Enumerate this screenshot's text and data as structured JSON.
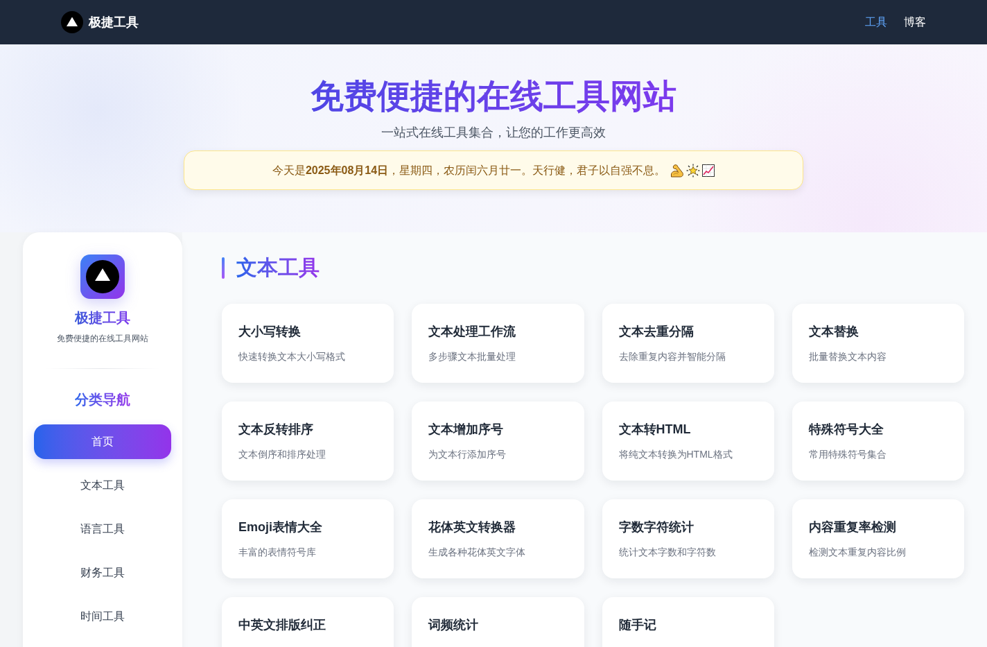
{
  "header": {
    "brand": "极捷工具",
    "nav": [
      {
        "label": "工具",
        "selected": true
      },
      {
        "label": "博客",
        "selected": false
      }
    ]
  },
  "hero": {
    "title": "免费便捷的在线工具网站",
    "subtitle": "一站式在线工具集合，让您的工作更高效",
    "notice": "今天是**2025年08月14日**，星期四，农历闰六月廿一。天行健，君子以自强不息。"
  },
  "sidebar": {
    "brand": "极捷工具",
    "tagline": "免费便捷的在线工具网站",
    "heading": "分类导航",
    "items": [
      {
        "label": "首页",
        "selected": true
      },
      {
        "label": "文本工具",
        "selected": false
      },
      {
        "label": "语言工具",
        "selected": false
      },
      {
        "label": "财务工具",
        "selected": false
      },
      {
        "label": "时间工具",
        "selected": false
      }
    ]
  },
  "section": {
    "title": "文本工具",
    "tools": [
      {
        "name": "大小写转换",
        "description": "快速转换文本大小写格式"
      },
      {
        "name": "文本处理工作流",
        "description": "多步骤文本批量处理"
      },
      {
        "name": "文本去重分隔",
        "description": "去除重复内容并智能分隔"
      },
      {
        "name": "文本替换",
        "description": "批量替换文本内容"
      },
      {
        "name": "文本反转排序",
        "description": "文本倒序和排序处理"
      },
      {
        "name": "文本增加序号",
        "description": "为文本行添加序号"
      },
      {
        "name": "文本转HTML",
        "description": "将纯文本转换为HTML格式"
      },
      {
        "name": "特殊符号大全",
        "description": "常用特殊符号集合"
      },
      {
        "name": "Emoji表情大全",
        "description": "丰富的表情符号库"
      },
      {
        "name": "花体英文转换器",
        "description": "生成各种花体英文字体"
      },
      {
        "name": "字数字符统计",
        "description": "统计文本字数和字符数"
      },
      {
        "name": "内容重复率检测",
        "description": "检测文本重复内容比例"
      },
      {
        "name": "中英文排版纠正"
      },
      {
        "name": "词频统计"
      },
      {
        "name": "随手记"
      }
    ]
  }
}
